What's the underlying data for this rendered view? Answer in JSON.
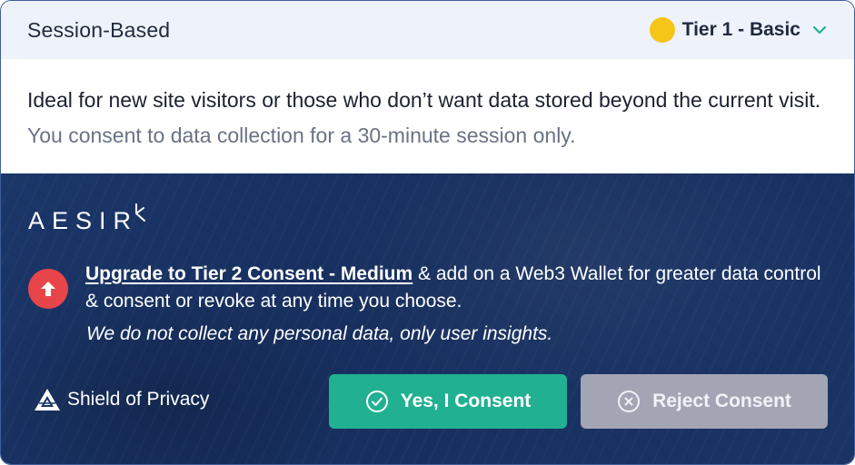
{
  "header": {
    "title": "Session-Based",
    "tier_label": "Tier 1 - Basic",
    "tier_color": "#f5c518"
  },
  "description": {
    "lead": "Ideal for new site visitors or those who don’t want data stored beyond the current visit.",
    "detail": " You consent to data collection for a 30-minute session only."
  },
  "panel": {
    "brand": "AESIR",
    "upgrade_link": "Upgrade to Tier 2 Consent - Medium",
    "upgrade_rest": " & add on a Web3 Wallet for greater data control & consent or revoke at any time you choose.",
    "note": "We do not collect any personal data, only user insights.",
    "shield_label": "Shield of Privacy",
    "background": "#1b3669"
  },
  "buttons": {
    "accept_label": "Yes, I Consent",
    "accept_color": "#21b092",
    "reject_label": "Reject Consent",
    "reject_color": "#a3a5b5"
  },
  "icons": {
    "tier": "yellow-dot",
    "dropdown": "chevron-down-icon",
    "upgrade": "arrow-up-icon",
    "shield": "shield-logo-icon",
    "accept": "check-circle-icon",
    "reject": "x-circle-icon"
  }
}
